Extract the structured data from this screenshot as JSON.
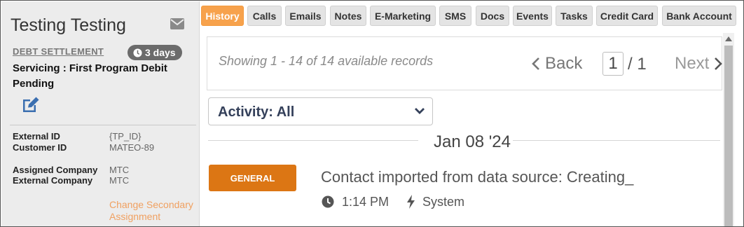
{
  "contact": {
    "name": "Testing Testing",
    "status": "DEBT SETTLEMENT",
    "days_badge": "3 days",
    "servicing": "Servicing : First Program Debit Pending"
  },
  "info": {
    "external_id_label": "External ID",
    "external_id_value": "{TP_ID}",
    "customer_id_label": "Customer ID",
    "customer_id_value": "MATEO-89",
    "assigned_company_label": "Assigned Company",
    "assigned_company_value": "MTC",
    "external_company_label": "External Company",
    "external_company_value": "MTC",
    "change_secondary_link": "Change Secondary Assignment"
  },
  "tabs": [
    {
      "label": "History",
      "active": true
    },
    {
      "label": "Calls"
    },
    {
      "label": "Emails"
    },
    {
      "label": "Notes"
    },
    {
      "label": "E-Marketing"
    },
    {
      "label": "SMS"
    },
    {
      "label": "Docs"
    },
    {
      "label": "Events"
    },
    {
      "label": "Tasks"
    },
    {
      "label": "Credit Card"
    },
    {
      "label": "Bank Account"
    }
  ],
  "records": {
    "showing_text": "Showing 1 - 14 of 14 available records",
    "back_label": "Back",
    "current_page": "1",
    "page_total": "/ 1",
    "next_label": "Next"
  },
  "filter": {
    "activity_label": "Activity: All"
  },
  "timeline": {
    "date": "Jan 08 '24",
    "entries": [
      {
        "badge": "GENERAL",
        "title": "Contact imported from data source: Creating_",
        "time": "1:14 PM",
        "source": "System"
      }
    ]
  },
  "colors": {
    "active_tab": "#f7a24c",
    "general_badge": "#dc7614",
    "link": "#f0a060",
    "days_badge": "#6b6b6b"
  },
  "icons": [
    "envelope-icon",
    "clock-icon",
    "edit-icon",
    "chevron-left-icon",
    "chevron-right-icon",
    "chevron-down-icon",
    "bolt-icon"
  ]
}
